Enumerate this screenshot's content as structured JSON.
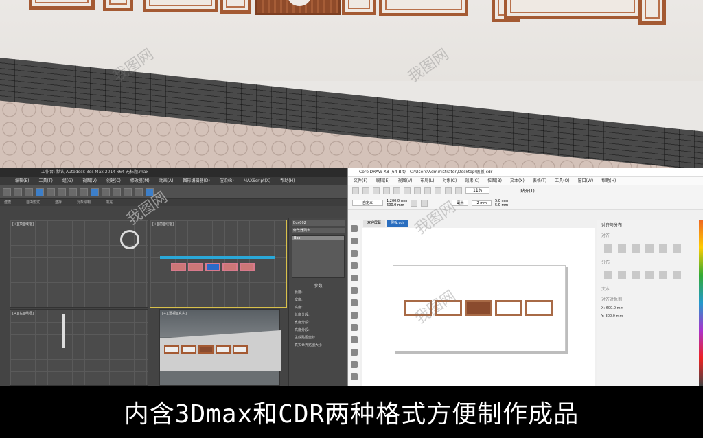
{
  "render": {
    "accent_wood": "#a45a33",
    "watermark": "我图网"
  },
  "max_app": {
    "title": "工作台: 默认        Autodesk 3ds Max 2014 x64        无标题.max",
    "menu": [
      "编辑(E)",
      "工具(T)",
      "组(G)",
      "视图(V)",
      "创建(C)",
      "修改器(M)",
      "动画(A)",
      "图形编辑器(D)",
      "渲染(R)",
      "MAXScript(X)",
      "帮助(H)"
    ],
    "ribbon": [
      "建模",
      "自由形式",
      "选择",
      "对象绘制",
      "填充"
    ],
    "viewports": {
      "top_left": "[+][顶][线框]",
      "top_right": "[+][前][线框]",
      "bottom_left": "[+][左][线框]",
      "bottom_right": "[+][透视][真实]"
    },
    "panel": {
      "object_name": "Box002",
      "modifier": "修改器列表",
      "stack_item": "Box",
      "params_title": "参数",
      "params": [
        "长度:",
        "宽度:",
        "高度:",
        "长度分段:",
        "宽度分段:",
        "高度分段:"
      ],
      "checks": [
        "生成贴图坐标",
        "真实世界贴图大小"
      ]
    }
  },
  "cdr_app": {
    "title": "CorelDRAW X8 (64-Bit) - C:\\Users\\Administrator\\Desktop\\展板.cdr",
    "menu": [
      "文件(F)",
      "编辑(E)",
      "视图(V)",
      "布局(L)",
      "对象(C)",
      "效果(C)",
      "位图(B)",
      "文本(X)",
      "表格(T)",
      "工具(O)",
      "窗口(W)",
      "帮助(H)"
    ],
    "zoom": "11%",
    "size_w": "1,200.0 mm",
    "size_h": "600.0 mm",
    "unit": "毫米",
    "nudge": "2 mm",
    "dup_x": "5.0 mm",
    "dup_y": "5.0 mm",
    "snap": "贴齐(T)",
    "preset": "自定义",
    "tabs": [
      "欢迎屏幕",
      "展板.cdr"
    ],
    "docker_title": "对齐与分布",
    "docker_sections": [
      "对齐",
      "分布",
      "文本",
      "对齐对象到"
    ],
    "coords": {
      "x": "X: 600.0 mm",
      "y": "Y: 300.0 mm"
    }
  },
  "caption": "内含3Dmax和CDR两种格式方便制作成品"
}
